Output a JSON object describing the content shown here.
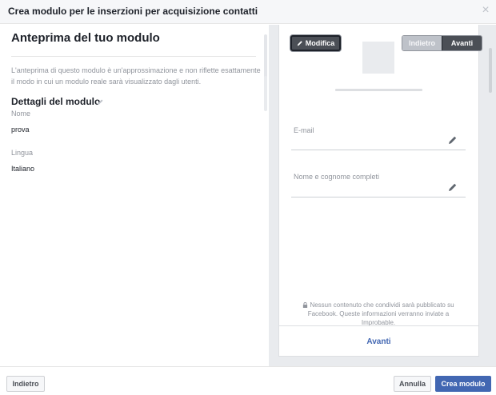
{
  "dialog": {
    "title": "Crea modulo per le inserzioni per acquisizione contatti"
  },
  "left": {
    "preview_title": "Anteprima del tuo modulo",
    "disclaimer": "L'anteprima di questo modulo è un'approssimazione e non riflette esattamente il modo in cui un modulo reale sarà visualizzato dagli utenti.",
    "details_title": "Dettagli del modulo",
    "name_label": "Nome",
    "name_value": "prova",
    "language_label": "Lingua",
    "language_value": "Italiano"
  },
  "preview": {
    "edit_label": "Modifica",
    "back_label": "Indietro",
    "next_label": "Avanti",
    "fields": [
      {
        "label": "E-mail"
      },
      {
        "label": "Nome e cognome completi"
      }
    ],
    "privacy_text": "Nessun contenuto che condividi sarà pubblicato su Facebook. Queste informazioni verranno inviate a Improbable.",
    "bottom_next_label": "Avanti"
  },
  "footer": {
    "back_label": "Indietro",
    "cancel_label": "Annulla",
    "create_label": "Crea modulo"
  },
  "colors": {
    "accent": "#4267b2",
    "dark_button": "#4b4f56",
    "muted_text": "#90949c"
  },
  "icons": {
    "close": "close-icon",
    "pencil": "pencil-icon",
    "lock": "lock-icon"
  }
}
